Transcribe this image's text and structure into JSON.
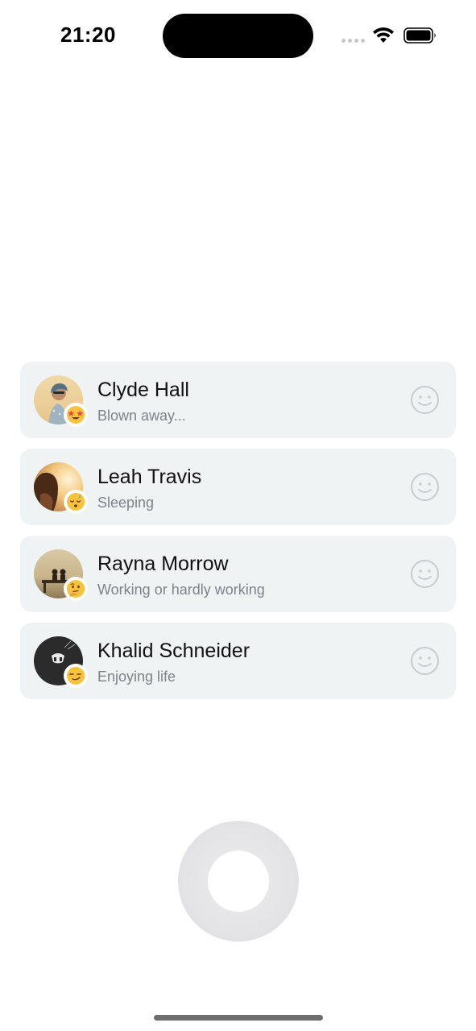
{
  "status_bar": {
    "time": "21:20"
  },
  "contacts": [
    {
      "name": "Clyde Hall",
      "status": "Blown away...",
      "emoji_icon": "star-struck-face-icon"
    },
    {
      "name": "Leah Travis",
      "status": "Sleeping",
      "emoji_icon": "sleeping-face-icon"
    },
    {
      "name": "Rayna Morrow",
      "status": "Working or hardly working",
      "emoji_icon": "thinking-face-icon"
    },
    {
      "name": "Khalid Schneider",
      "status": "Enjoying life",
      "emoji_icon": "smirking-face-icon"
    }
  ],
  "colors": {
    "card_background": "#f0f3f4",
    "status_text": "#7d8389",
    "emoji_yellow": "#f7c33c"
  }
}
